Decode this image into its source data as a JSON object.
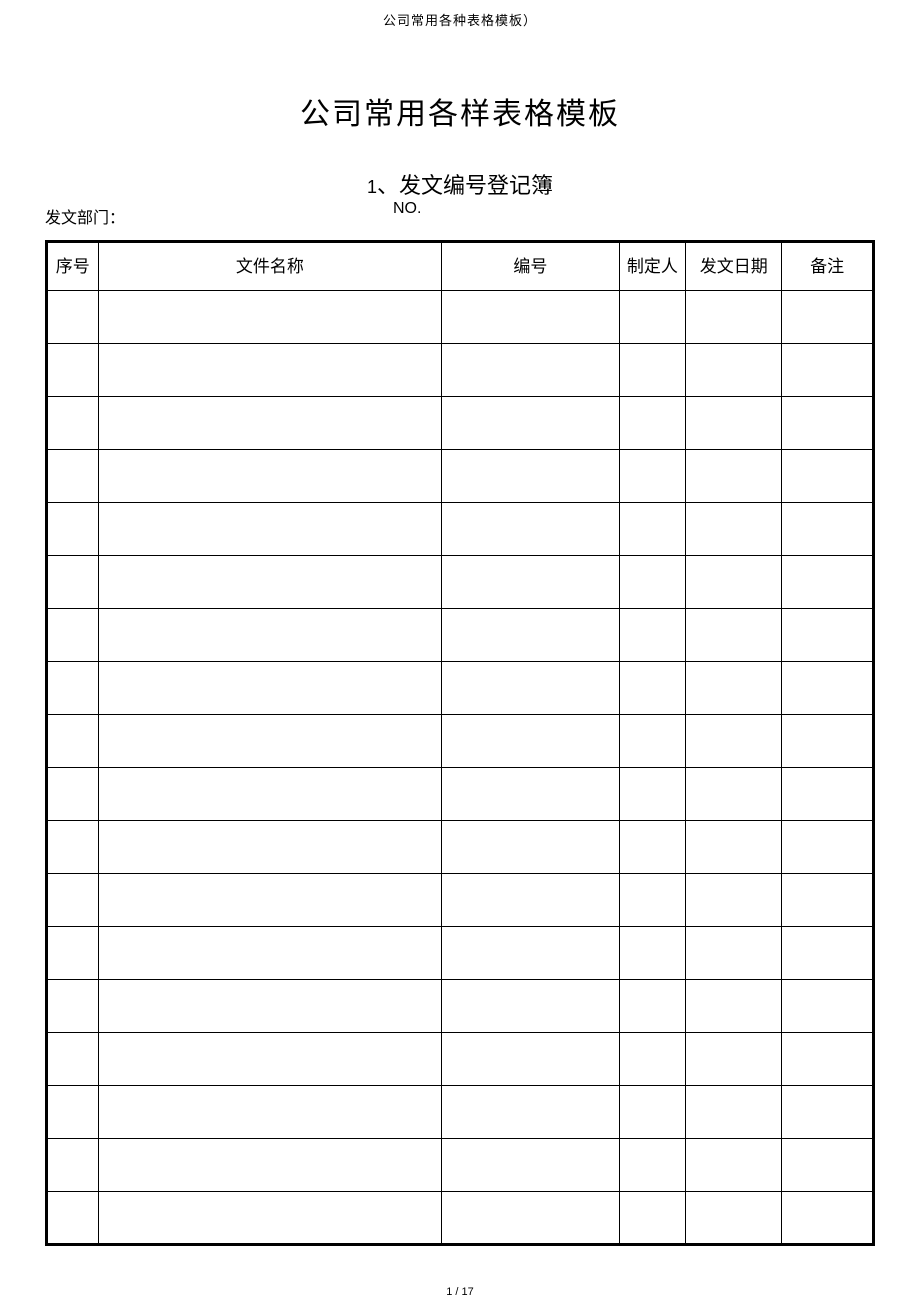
{
  "header": "公司常用各种表格模板）",
  "main_title": "公司常用各样表格模板",
  "sub_title_prefix": "1",
  "sub_title_text": "、发文编号登记簿",
  "dept_label": "发文部门：",
  "no_label": "NO.",
  "columns": {
    "seq": "序号",
    "name": "文件名称",
    "code": "编号",
    "author": "制定人",
    "date": "发文日期",
    "remark": "备注"
  },
  "rows": [
    {
      "seq": "",
      "name": "",
      "code": "",
      "author": "",
      "date": "",
      "remark": ""
    },
    {
      "seq": "",
      "name": "",
      "code": "",
      "author": "",
      "date": "",
      "remark": ""
    },
    {
      "seq": "",
      "name": "",
      "code": "",
      "author": "",
      "date": "",
      "remark": ""
    },
    {
      "seq": "",
      "name": "",
      "code": "",
      "author": "",
      "date": "",
      "remark": ""
    },
    {
      "seq": "",
      "name": "",
      "code": "",
      "author": "",
      "date": "",
      "remark": ""
    },
    {
      "seq": "",
      "name": "",
      "code": "",
      "author": "",
      "date": "",
      "remark": ""
    },
    {
      "seq": "",
      "name": "",
      "code": "",
      "author": "",
      "date": "",
      "remark": ""
    },
    {
      "seq": "",
      "name": "",
      "code": "",
      "author": "",
      "date": "",
      "remark": ""
    },
    {
      "seq": "",
      "name": "",
      "code": "",
      "author": "",
      "date": "",
      "remark": ""
    },
    {
      "seq": "",
      "name": "",
      "code": "",
      "author": "",
      "date": "",
      "remark": ""
    },
    {
      "seq": "",
      "name": "",
      "code": "",
      "author": "",
      "date": "",
      "remark": ""
    },
    {
      "seq": "",
      "name": "",
      "code": "",
      "author": "",
      "date": "",
      "remark": ""
    },
    {
      "seq": "",
      "name": "",
      "code": "",
      "author": "",
      "date": "",
      "remark": ""
    },
    {
      "seq": "",
      "name": "",
      "code": "",
      "author": "",
      "date": "",
      "remark": ""
    },
    {
      "seq": "",
      "name": "",
      "code": "",
      "author": "",
      "date": "",
      "remark": ""
    },
    {
      "seq": "",
      "name": "",
      "code": "",
      "author": "",
      "date": "",
      "remark": ""
    },
    {
      "seq": "",
      "name": "",
      "code": "",
      "author": "",
      "date": "",
      "remark": ""
    },
    {
      "seq": "",
      "name": "",
      "code": "",
      "author": "",
      "date": "",
      "remark": ""
    }
  ],
  "footer": "1 / 17"
}
